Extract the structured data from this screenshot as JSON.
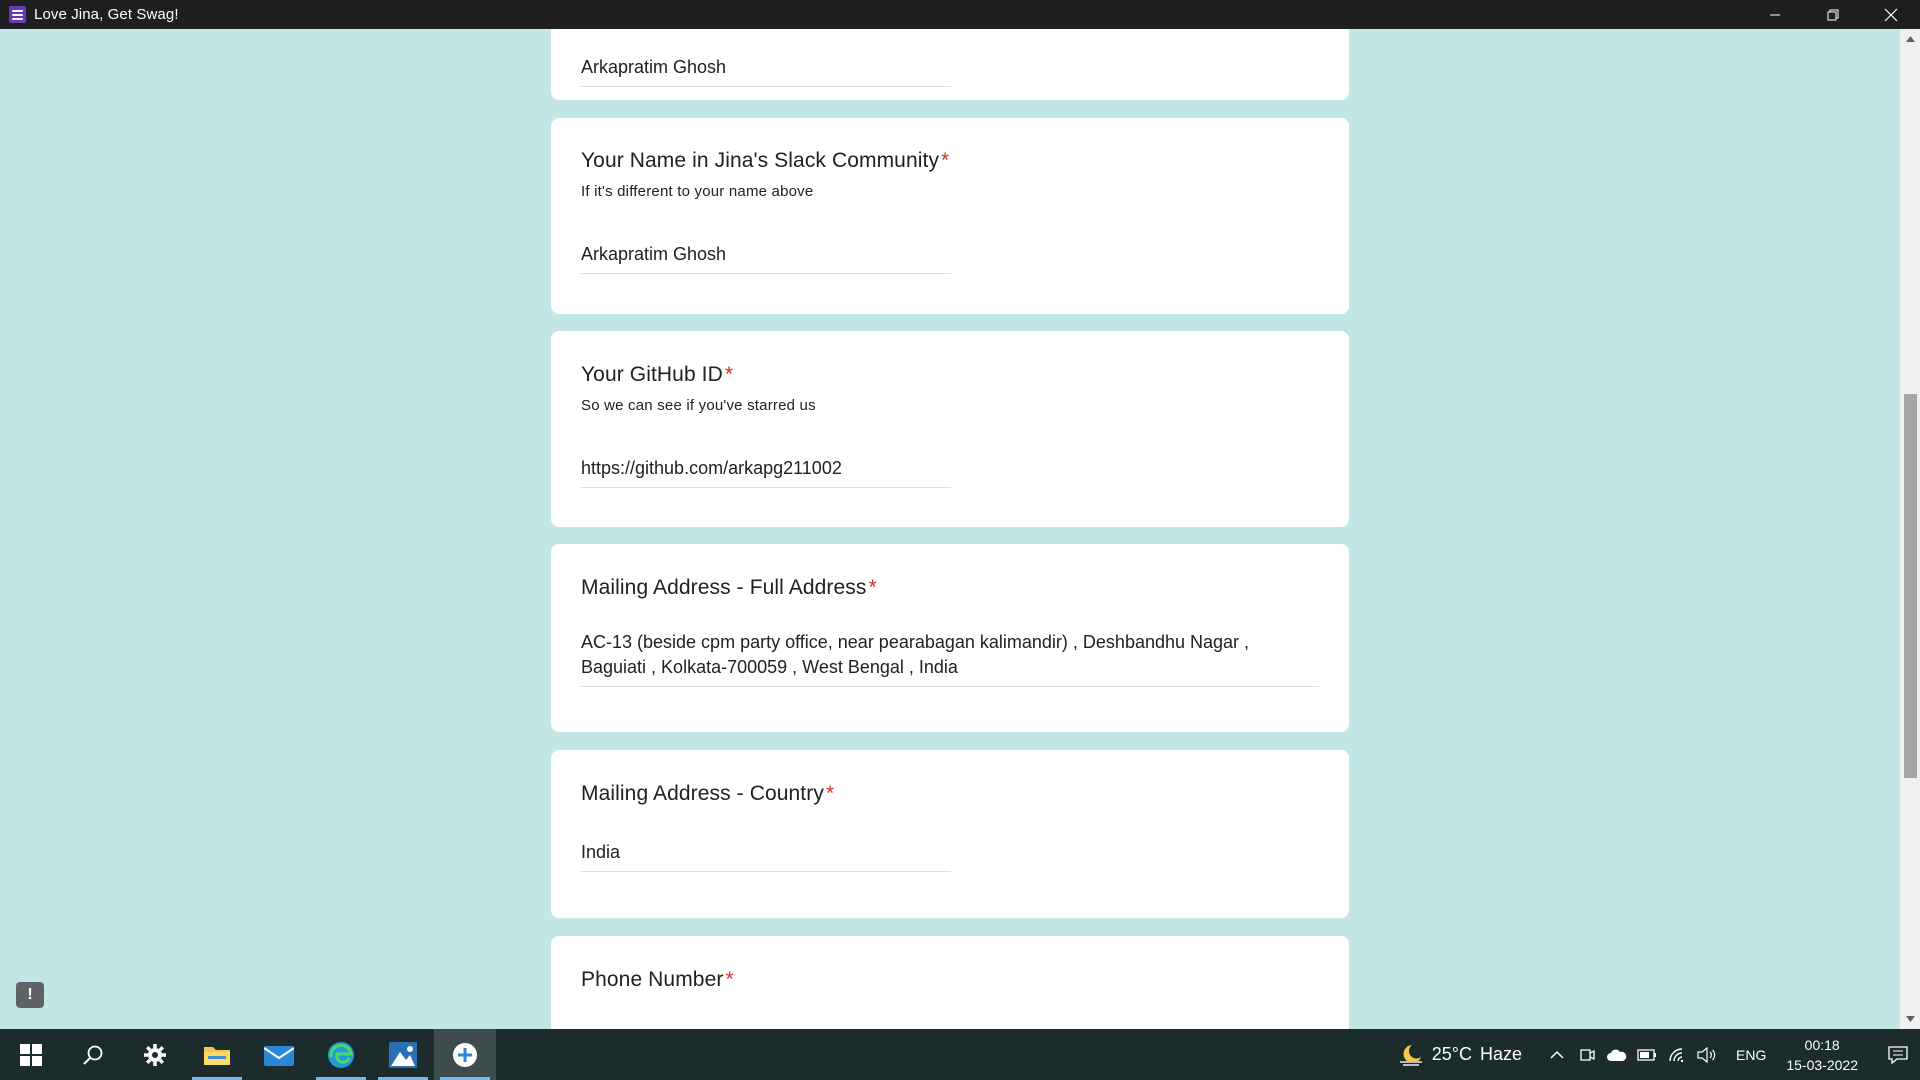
{
  "window": {
    "title": "Love Jina, Get Swag!"
  },
  "form": {
    "previous_answer": "Arkapratim Ghosh",
    "questions": [
      {
        "title": "Your Name in Jina's Slack Community",
        "required_mark": "*",
        "description": "If it's different to your name above",
        "answer": "Arkapratim Ghosh"
      },
      {
        "title": "Your GitHub ID",
        "required_mark": "*",
        "description": "So we can see if you've starred us",
        "answer": "https://github.com/arkapg211002"
      },
      {
        "title": "Mailing Address - Full Address",
        "required_mark": "*",
        "answer": "AC-13 (beside cpm party office, near pearabagan kalimandir) , Deshbandhu Nagar , Baguiati , Kolkata-700059 , West Bengal , India"
      },
      {
        "title": "Mailing Address - Country",
        "required_mark": "*",
        "answer": "India"
      },
      {
        "title": "Phone Number",
        "required_mark": "*"
      }
    ]
  },
  "taskbar": {
    "weather_temp": "25°C",
    "weather_desc": "Haze",
    "language": "ENG",
    "time": "00:18",
    "date": "15-03-2022"
  },
  "colors": {
    "background": "#c2e6e6",
    "required": "#d93025",
    "taskbar": "#1c2b2b"
  }
}
